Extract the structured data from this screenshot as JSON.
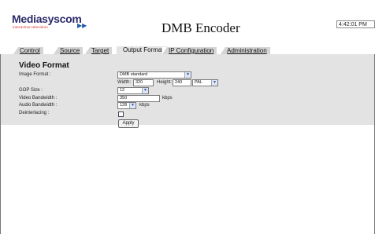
{
  "app": {
    "brand_name": "Mediasyscom",
    "brand_tagline": "interactive television",
    "title": "DMB Encoder",
    "clock": "4:42:01 PM"
  },
  "tabs": [
    {
      "label": "Control",
      "active": false
    },
    {
      "label": "Source",
      "active": false
    },
    {
      "label": "Target",
      "active": false
    },
    {
      "label": "Output Format",
      "active": true
    },
    {
      "label": "IP Configuration",
      "active": false
    },
    {
      "label": "Administration",
      "active": false
    }
  ],
  "form": {
    "section_title": "Video Format",
    "image_format_label": "Image Format :",
    "image_format_value": "DMB standard",
    "width_label": "Width:",
    "width_value": "320",
    "height_label": "Height:",
    "height_value": "240",
    "standard_value": "PAL",
    "gop_label": "GOP Size :",
    "gop_value": "12",
    "video_bw_label": "Video Bandwidth :",
    "video_bw_value": "350",
    "video_bw_unit": "kbps",
    "audio_bw_label": "Audio Bandwidth :",
    "audio_bw_value": "128",
    "audio_bw_unit": "kbps",
    "deinterlacing_label": "Deinterlacing :",
    "deinterlacing_checked": false,
    "apply_label": "Apply"
  },
  "colors": {
    "panel_bg": "#e3e3e3",
    "tab_bg": "#d5d5d5",
    "brand_red": "#d21f1f",
    "brand_navy": "#2a2a6a"
  }
}
